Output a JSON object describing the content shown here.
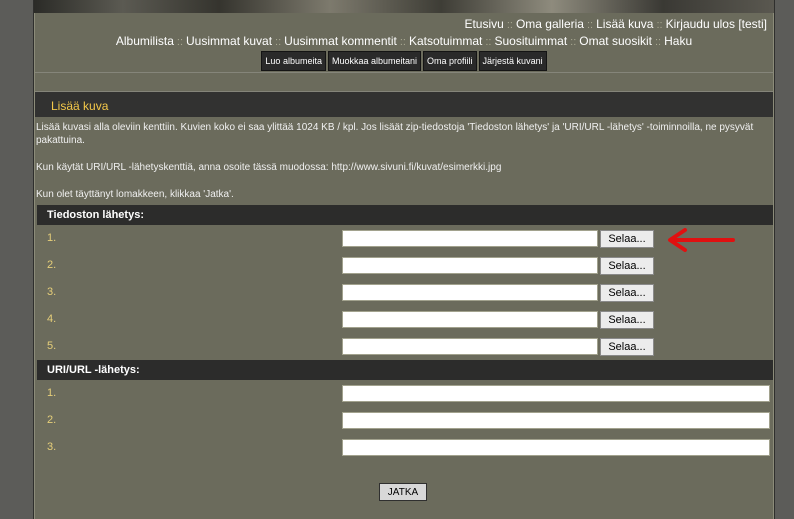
{
  "top_nav": {
    "home": "Etusivu",
    "my_gallery": "Oma galleria",
    "add_image": "Lisää kuva",
    "logout": "Kirjaudu ulos [testi]"
  },
  "second_nav": {
    "album_list": "Albumilista",
    "newest_images": "Uusimmat kuvat",
    "newest_comments": "Uusimmat kommentit",
    "most_viewed": "Katsotuimmat",
    "most_popular": "Suosituimmat",
    "my_favorites": "Omat suosikit",
    "search": "Haku"
  },
  "separator": "::",
  "tabs": [
    "Luo albumeita",
    "Muokkaa albumeitani",
    "Oma profiili",
    "Järjestä kuvani"
  ],
  "panel": {
    "title": "Lisää kuva",
    "intro_1": "Lisää kuvasi alla oleviin kenttiin. Kuvien koko ei saa ylittää 1024 KB / kpl. Jos lisäät zip-tiedostoja 'Tiedoston lähetys' ja 'URI/URL -lähetys' -toiminnoilla, ne pysyvät pakattuina.",
    "intro_2": "Kun käytät URI/URL -lähetyskenttiä, anna osoite tässä muodossa: http://www.sivuni.fi/kuvat/esimerkki.jpg",
    "intro_3": "Kun olet täyttänyt lomakkeen, klikkaa 'Jatka'."
  },
  "file_upload": {
    "heading": "Tiedoston lähetys:",
    "rows": [
      {
        "num": "1.",
        "value": ""
      },
      {
        "num": "2.",
        "value": ""
      },
      {
        "num": "3.",
        "value": ""
      },
      {
        "num": "4.",
        "value": ""
      },
      {
        "num": "5.",
        "value": ""
      }
    ],
    "browse_label": "Selaa..."
  },
  "url_upload": {
    "heading": "URI/URL -lähetys:",
    "rows": [
      {
        "num": "1.",
        "value": ""
      },
      {
        "num": "2.",
        "value": ""
      },
      {
        "num": "3.",
        "value": ""
      }
    ]
  },
  "submit_label": "JATKA",
  "annotation": {
    "icon": "red-arrow-icon",
    "color": "#e01010"
  },
  "colors": {
    "title_text": "#f4c84a",
    "row_number": "#e6cf7a",
    "page_bg": "#6b6b5c",
    "header_bar": "#2c2c2b"
  }
}
